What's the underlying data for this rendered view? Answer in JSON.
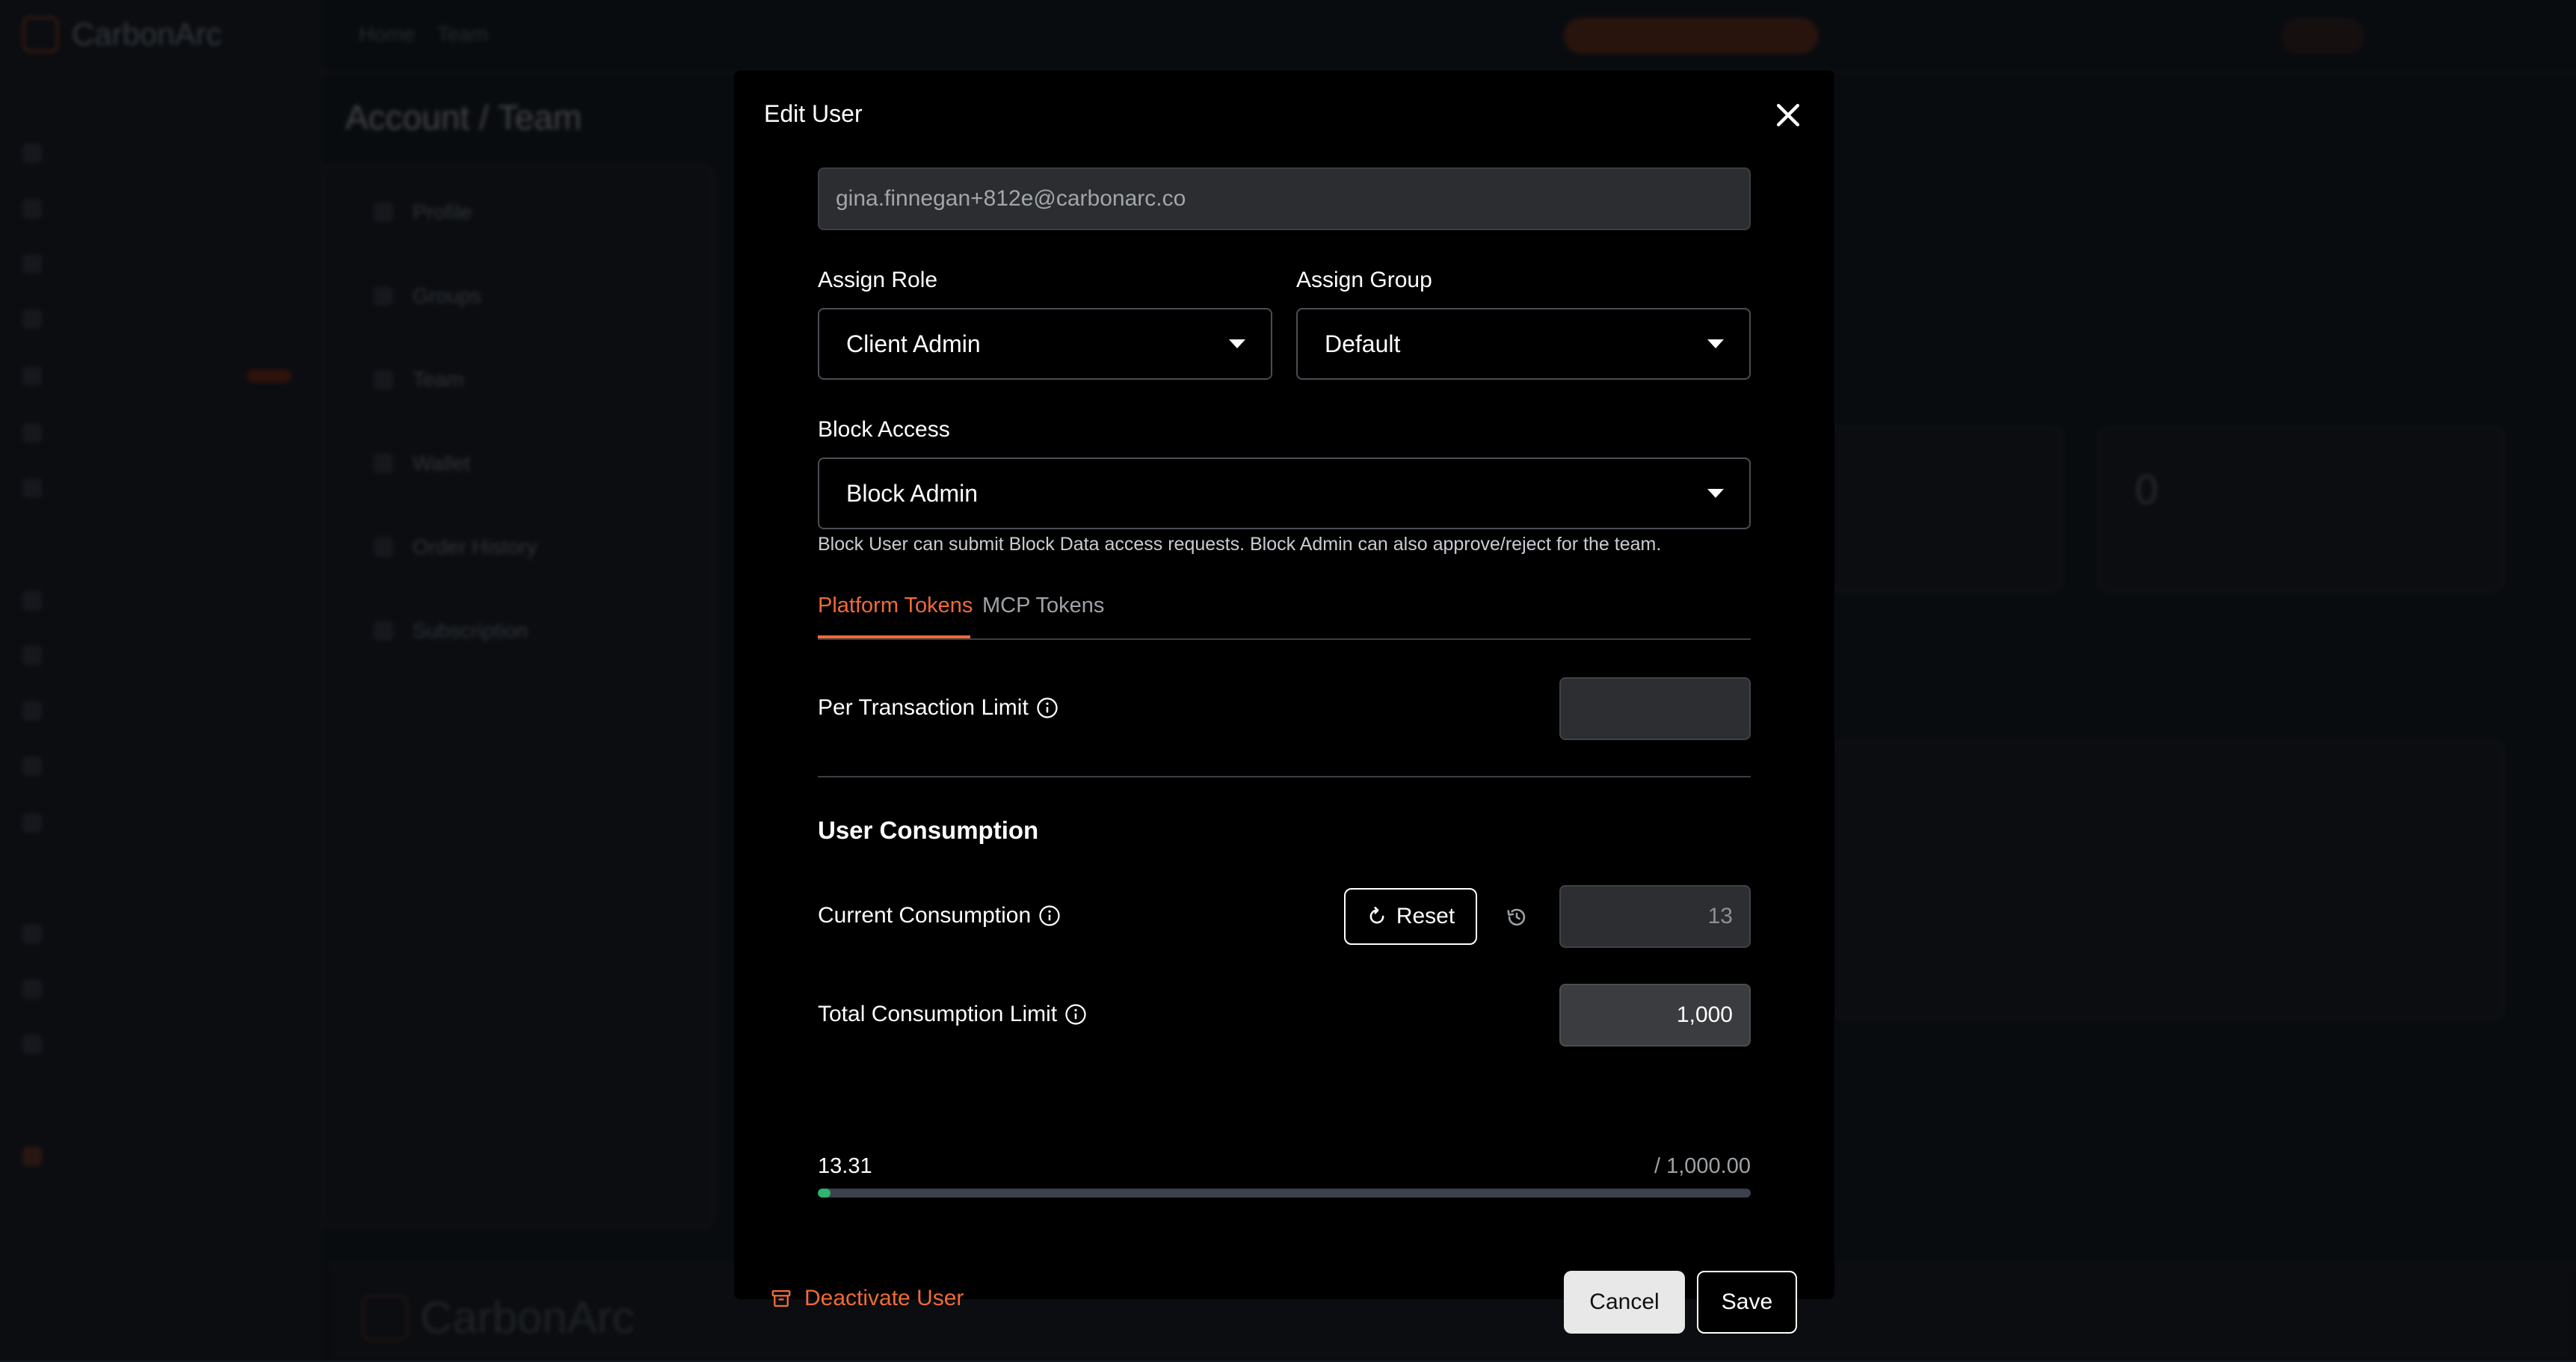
{
  "background": {
    "logo_text": "CarbonArc",
    "breadcrumb": [
      "Home",
      "Team"
    ],
    "page_title": "Account / Team",
    "sub_nav": [
      "Profile",
      "Groups",
      "Team",
      "Wallet",
      "Order History",
      "Subscription"
    ],
    "stat_value": "0"
  },
  "modal": {
    "title": "Edit User",
    "email_value": "gina.finnegan+812e@carbonarc.co",
    "assign_role": {
      "label": "Assign Role",
      "value": "Client Admin"
    },
    "assign_group": {
      "label": "Assign Group",
      "value": "Default"
    },
    "block_access": {
      "label": "Block Access",
      "value": "Block Admin",
      "help": "Block User can submit Block Data access requests. Block Admin can also approve/reject for the team."
    },
    "tabs": [
      {
        "label": "Platform Tokens",
        "active": true
      },
      {
        "label": "MCP Tokens",
        "active": false
      }
    ],
    "per_transaction_limit": {
      "label": "Per Transaction Limit",
      "value": ""
    },
    "user_consumption": {
      "title": "User Consumption",
      "current_label": "Current Consumption",
      "reset_label": "Reset",
      "current_value": "13",
      "total_label": "Total Consumption Limit",
      "total_value": "1,000",
      "progress_used": "13.31",
      "progress_total": "/  1,000.00",
      "progress_fraction": 0.01331
    },
    "deactivate_label": "Deactivate User",
    "cancel_label": "Cancel",
    "save_label": "Save"
  },
  "colors": {
    "accent": "#f06a37",
    "progress": "#2fb36d",
    "modal_bg": "#000000"
  },
  "icons": [
    "close-icon",
    "info-icon",
    "reset-icon",
    "history-icon",
    "archive-icon",
    "chevron-down-icon"
  ]
}
